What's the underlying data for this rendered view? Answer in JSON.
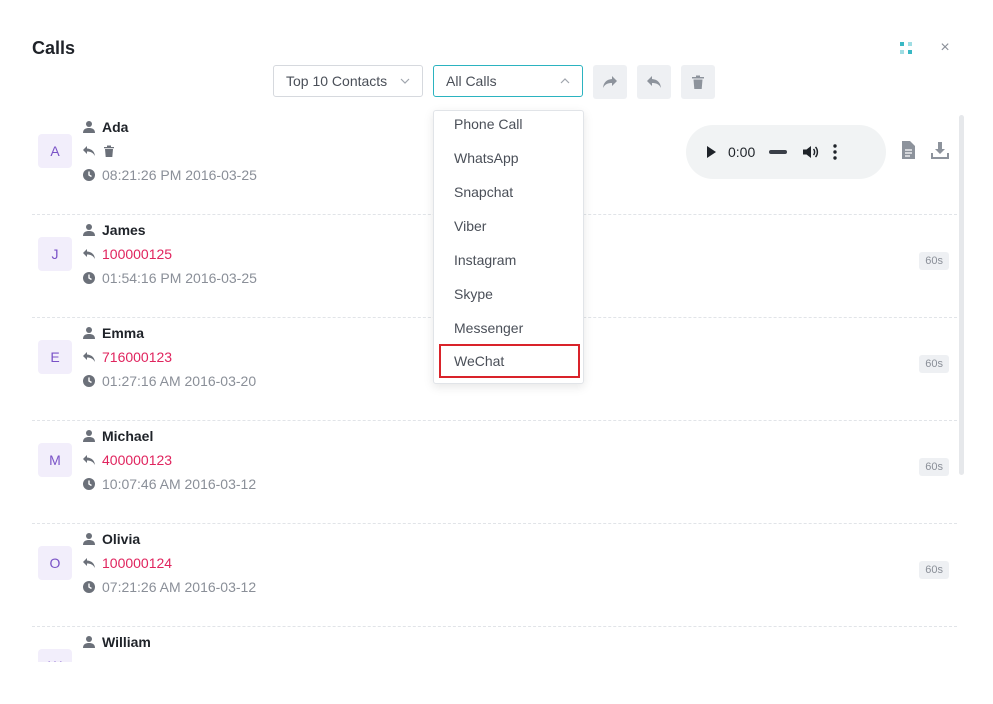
{
  "dialog": {
    "title": "Calls",
    "close_symbol": "×"
  },
  "filters": {
    "contacts_value": "Top 10 Contacts",
    "calls_value": "All Calls",
    "call_type_options": [
      "Phone Call",
      "WhatsApp",
      "Snapchat",
      "Viber",
      "Instagram",
      "Skype",
      "Messenger",
      "WeChat"
    ],
    "highlighted_option": "WeChat"
  },
  "toolbar": {
    "buttons": [
      "forward-icon",
      "reply-icon",
      "trash-icon"
    ]
  },
  "player": {
    "time": "0:00"
  },
  "calls": [
    {
      "initial": "A",
      "name": "Ada",
      "number": "",
      "datetime": "08:21:26 PM 2016-03-25",
      "duration": ""
    },
    {
      "initial": "J",
      "name": "James",
      "number": "100000125",
      "datetime": "01:54:16 PM 2016-03-25",
      "duration": "60s"
    },
    {
      "initial": "E",
      "name": "Emma",
      "number": "716000123",
      "datetime": "01:27:16 AM 2016-03-20",
      "duration": "60s"
    },
    {
      "initial": "M",
      "name": "Michael",
      "number": "400000123",
      "datetime": "10:07:46 AM 2016-03-12",
      "duration": "60s"
    },
    {
      "initial": "O",
      "name": "Olivia",
      "number": "100000124",
      "datetime": "07:21:26 AM 2016-03-12",
      "duration": "60s"
    },
    {
      "initial": "W",
      "name": "William",
      "number": "",
      "datetime": "",
      "duration": ""
    }
  ],
  "colors": {
    "accent": "#2bb3c0",
    "number": "#e0245e",
    "avatar_text": "#7a52c7",
    "highlight_border": "#d9232a"
  }
}
